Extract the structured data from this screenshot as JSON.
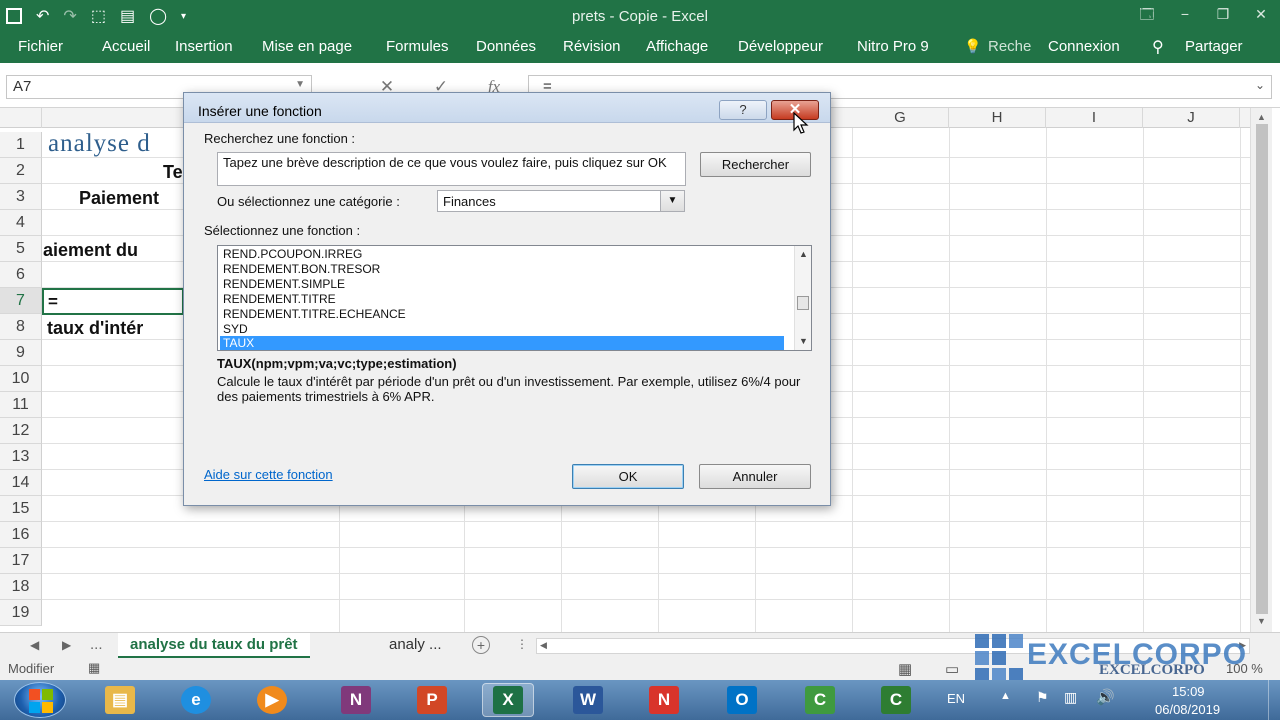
{
  "window": {
    "title": "prets - Copie - Excel",
    "controls": [
      "🗔",
      "−",
      "❐",
      "✕"
    ]
  },
  "ribbon": {
    "tabs": [
      "Fichier",
      "Accueil",
      "Insertion",
      "Mise en page",
      "Formules",
      "Données",
      "Révision",
      "Affichage",
      "Développeur",
      "Nitro Pro 9",
      "Reche",
      "Connexion",
      "Partager"
    ]
  },
  "formula_bar": {
    "name_box": "A7",
    "formula": "=",
    "fx_label": "fx"
  },
  "grid": {
    "columns": [
      "G",
      "H",
      "I",
      "J"
    ],
    "rows": [
      "1",
      "2",
      "3",
      "4",
      "5",
      "6",
      "7",
      "8",
      "9",
      "10",
      "11",
      "12",
      "13",
      "14",
      "15",
      "16",
      "17",
      "18",
      "19"
    ],
    "selected_row": "7",
    "cells": {
      "a1": "analyse d",
      "a2": "Te",
      "a3": "Paiement",
      "a5": "aiement du",
      "a7": "=",
      "a8": "taux d'intér"
    }
  },
  "sheet_tabs": {
    "ellipsis": "...",
    "active": "analyse du taux du prêt",
    "other": "analy ...",
    "add": "+"
  },
  "status_bar": {
    "mode": "Modifier",
    "zoom": "100 %"
  },
  "dialog": {
    "title": "Insérer une fonction",
    "help_label": "?",
    "close_label": "✕",
    "search_label": "Recherchez une fonction :",
    "search_placeholder": "Tapez une brève description de ce que vous voulez faire, puis cliquez sur OK",
    "search_button": "Rechercher",
    "category_label": "Ou sélectionnez une catégorie :",
    "category_value": "Finances",
    "function_label": "Sélectionnez une fonction :",
    "functions": [
      "REND.PCOUPON.IRREG",
      "RENDEMENT.BON.TRESOR",
      "RENDEMENT.SIMPLE",
      "RENDEMENT.TITRE",
      "RENDEMENT.TITRE.ECHEANCE",
      "SYD",
      "TAUX"
    ],
    "selected_function": "TAUX",
    "syntax": "TAUX(npm;vpm;va;vc;type;estimation)",
    "description": "Calcule le taux d'intérêt par période d'un prêt ou d'un investissement. Par exemple, utilisez 6%/4 pour des paiements trimestriels à 6% APR.",
    "help_link": "Aide sur cette fonction",
    "ok_button": "OK",
    "cancel_button": "Annuler"
  },
  "watermark": {
    "brand": "EXCELCORPO",
    "brand_small": "EXCELCORPO"
  },
  "taskbar": {
    "language": "EN",
    "time": "15:09",
    "date": "06/08/2019",
    "apps": [
      {
        "name": "explorer",
        "glyph": "▤",
        "color": "#e8b84a"
      },
      {
        "name": "internet-explorer",
        "glyph": "e",
        "color": "#1f8fe0"
      },
      {
        "name": "media-player",
        "glyph": "▶",
        "color": "#f08a1c"
      },
      {
        "name": "onenote",
        "glyph": "N",
        "color": "#80397b"
      },
      {
        "name": "powerpoint",
        "glyph": "P",
        "color": "#d24726"
      },
      {
        "name": "excel",
        "glyph": "X",
        "color": "#1e7145"
      },
      {
        "name": "word",
        "glyph": "W",
        "color": "#2b579a"
      },
      {
        "name": "nitro",
        "glyph": "N",
        "color": "#d9342b"
      },
      {
        "name": "outlook",
        "glyph": "O",
        "color": "#0072c6"
      },
      {
        "name": "camtasia",
        "glyph": "C",
        "color": "#3f9a3f"
      },
      {
        "name": "camtasia-2",
        "glyph": "C",
        "color": "#2e7d32"
      }
    ]
  }
}
